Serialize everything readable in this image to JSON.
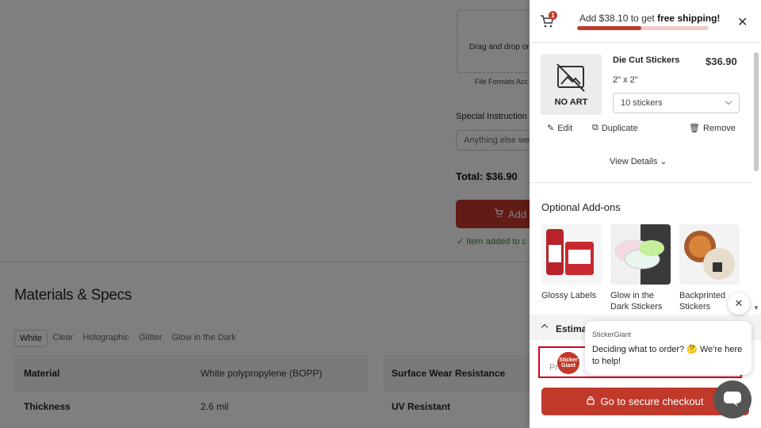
{
  "background_page": {
    "upload_text": "Drag and drop or",
    "file_formats": "File Formats Acc",
    "special_instructions_label": "Special Instruction",
    "special_instructions_placeholder": "Anything else we",
    "total": "Total: $36.90",
    "add_button_label": "Add",
    "added_message": "Item added to c",
    "materials_title": "Materials & Specs",
    "tabs": [
      "White",
      "Clear",
      "Holographic",
      "Glitter",
      "Glow in the Dark"
    ],
    "specs": [
      {
        "label": "Material",
        "value": "White polypropylene (BOPP)"
      },
      {
        "label": "Thickness",
        "value": "2.6 mil"
      }
    ],
    "specs_right": [
      "Surface Wear Resistance",
      "UV Resistant"
    ]
  },
  "cart": {
    "badge_count": "1",
    "shipping_text_prefix": "Add $38.10 to get ",
    "shipping_text_bold": "free shipping!",
    "shipping_progress_percent": 49,
    "item": {
      "thumb_label": "NO ART",
      "name": "Die Cut Stickers",
      "price": "$36.90",
      "size": "2\" x 2\"",
      "quantity": "10 stickers",
      "edit": "Edit",
      "duplicate": "Duplicate",
      "remove": "Remove",
      "view_details": "View Details"
    },
    "addons_title": "Optional Add-ons",
    "addons": [
      "Glossy Labels",
      "Glow in the Dark Stickers",
      "Backprinted Stickers"
    ],
    "estimate_label": "Estima",
    "promo_placeholder": "Pr",
    "checkout_label": "Go to secure checkout"
  },
  "chat": {
    "sender": "StickerGiant",
    "message": "Deciding what to order? 🤔 We're here to help!",
    "avatar_text": "Sticker Giant"
  },
  "colors": {
    "accent": "#c0392b",
    "success": "#2e8b3a",
    "highlight_outline": "#d0021b"
  }
}
